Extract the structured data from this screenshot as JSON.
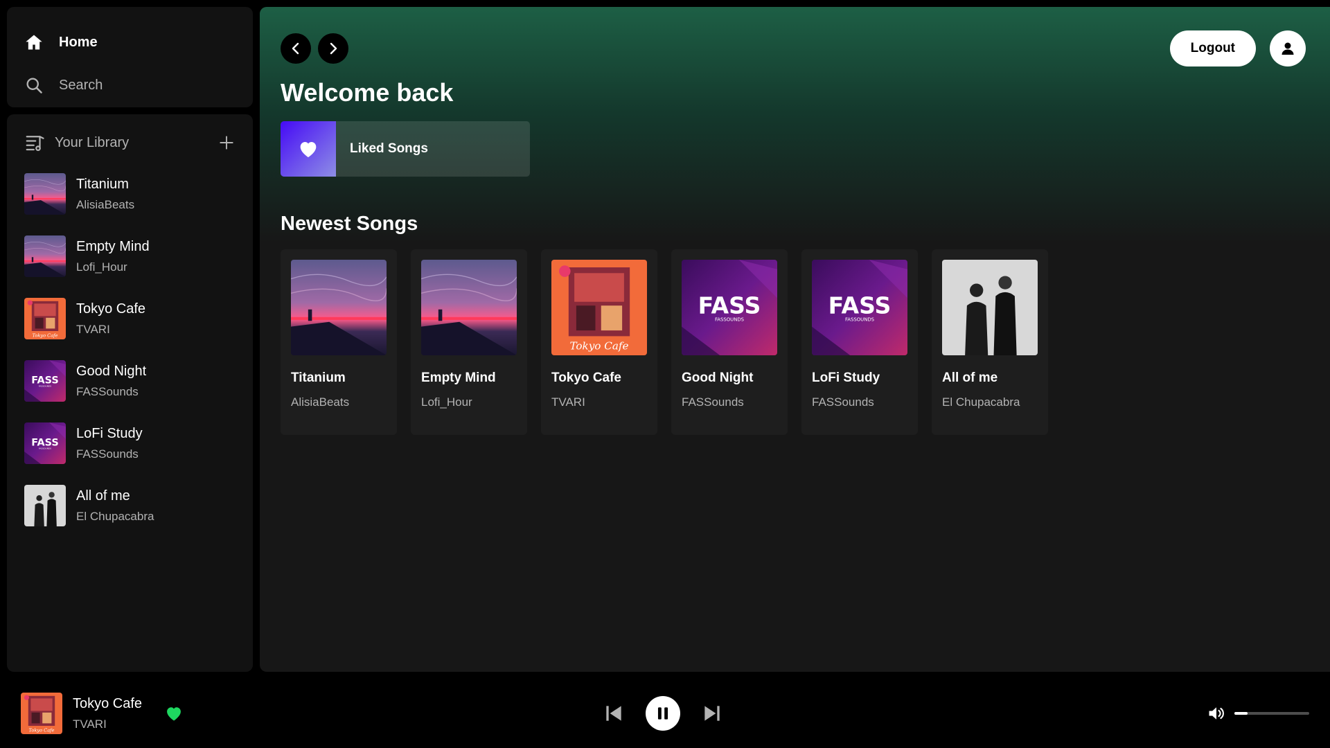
{
  "nav": {
    "home_label": "Home",
    "search_label": "Search"
  },
  "library": {
    "title": "Your Library",
    "items": [
      {
        "title": "Titanium",
        "artist": "AlisiaBeats",
        "art": "sunset-art"
      },
      {
        "title": "Empty Mind",
        "artist": "Lofi_Hour",
        "art": "sunset-art"
      },
      {
        "title": "Tokyo Cafe",
        "artist": "TVARI",
        "art": "tokyo-art"
      },
      {
        "title": "Good Night",
        "artist": "FASSounds",
        "art": "fass-art"
      },
      {
        "title": "LoFi Study",
        "artist": "FASSounds",
        "art": "fass-art"
      },
      {
        "title": "All of me",
        "artist": "El Chupacabra",
        "art": "duo-art"
      }
    ]
  },
  "header": {
    "logout_label": "Logout",
    "welcome": "Welcome back",
    "liked_songs_label": "Liked Songs"
  },
  "newest": {
    "title": "Newest Songs",
    "songs": [
      {
        "title": "Titanium",
        "artist": "AlisiaBeats",
        "art": "sunset-art"
      },
      {
        "title": "Empty Mind",
        "artist": "Lofi_Hour",
        "art": "sunset-art"
      },
      {
        "title": "Tokyo Cafe",
        "artist": "TVARI",
        "art": "tokyo-art"
      },
      {
        "title": "Good Night",
        "artist": "FASSounds",
        "art": "fass-art"
      },
      {
        "title": "LoFi Study",
        "artist": "FASSounds",
        "art": "fass-art"
      },
      {
        "title": "All of me",
        "artist": "El Chupacabra",
        "art": "duo-art"
      }
    ]
  },
  "player": {
    "title": "Tokyo Cafe",
    "artist": "TVARI",
    "art": "tokyo-art",
    "volume_fraction": 0.18,
    "is_playing": true,
    "liked": true
  },
  "colors": {
    "accent": "#1ed760",
    "header_green": "#1d5f45",
    "panel_bg": "#121212"
  }
}
